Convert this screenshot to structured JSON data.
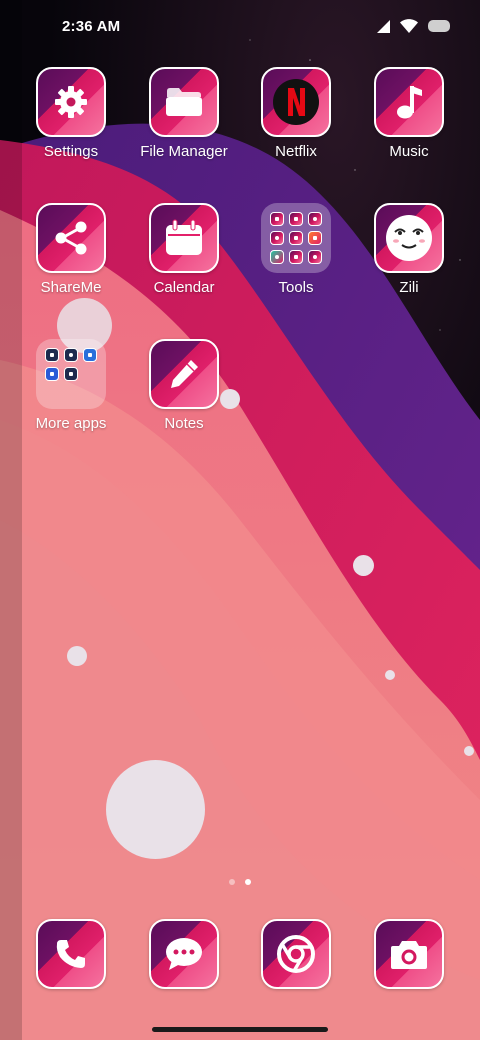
{
  "status_bar": {
    "time": "2:36 AM"
  },
  "apps": {
    "settings": {
      "label": "Settings",
      "icon": "gear-icon"
    },
    "file_manager": {
      "label": "File Manager",
      "icon": "folder-icon"
    },
    "netflix": {
      "label": "Netflix",
      "icon": "netflix-logo"
    },
    "music": {
      "label": "Music",
      "icon": "music-note-icon"
    },
    "shareme": {
      "label": "ShareMe",
      "icon": "share-icon"
    },
    "calendar": {
      "label": "Calendar",
      "icon": "calendar-icon"
    },
    "tools": {
      "label": "Tools",
      "icon": "folder-grid"
    },
    "zili": {
      "label": "Zili",
      "icon": "smiley-face-icon"
    },
    "more_apps": {
      "label": "More apps",
      "icon": "folder-grid"
    },
    "notes": {
      "label": "Notes",
      "icon": "pencil-icon"
    }
  },
  "dock": [
    {
      "name": "phone",
      "icon": "phone-icon"
    },
    {
      "name": "messages",
      "icon": "chat-bubble-icon"
    },
    {
      "name": "browser",
      "icon": "chrome-icon"
    },
    {
      "name": "camera",
      "icon": "camera-icon"
    }
  ],
  "page_indicator": {
    "pages": 2,
    "active": 2
  },
  "colors": {
    "tile_dark": "#5a0c58",
    "tile_mid": "#d3185f",
    "tile_light": "#f5729e",
    "wallpaper_pink": "#f27d84"
  }
}
